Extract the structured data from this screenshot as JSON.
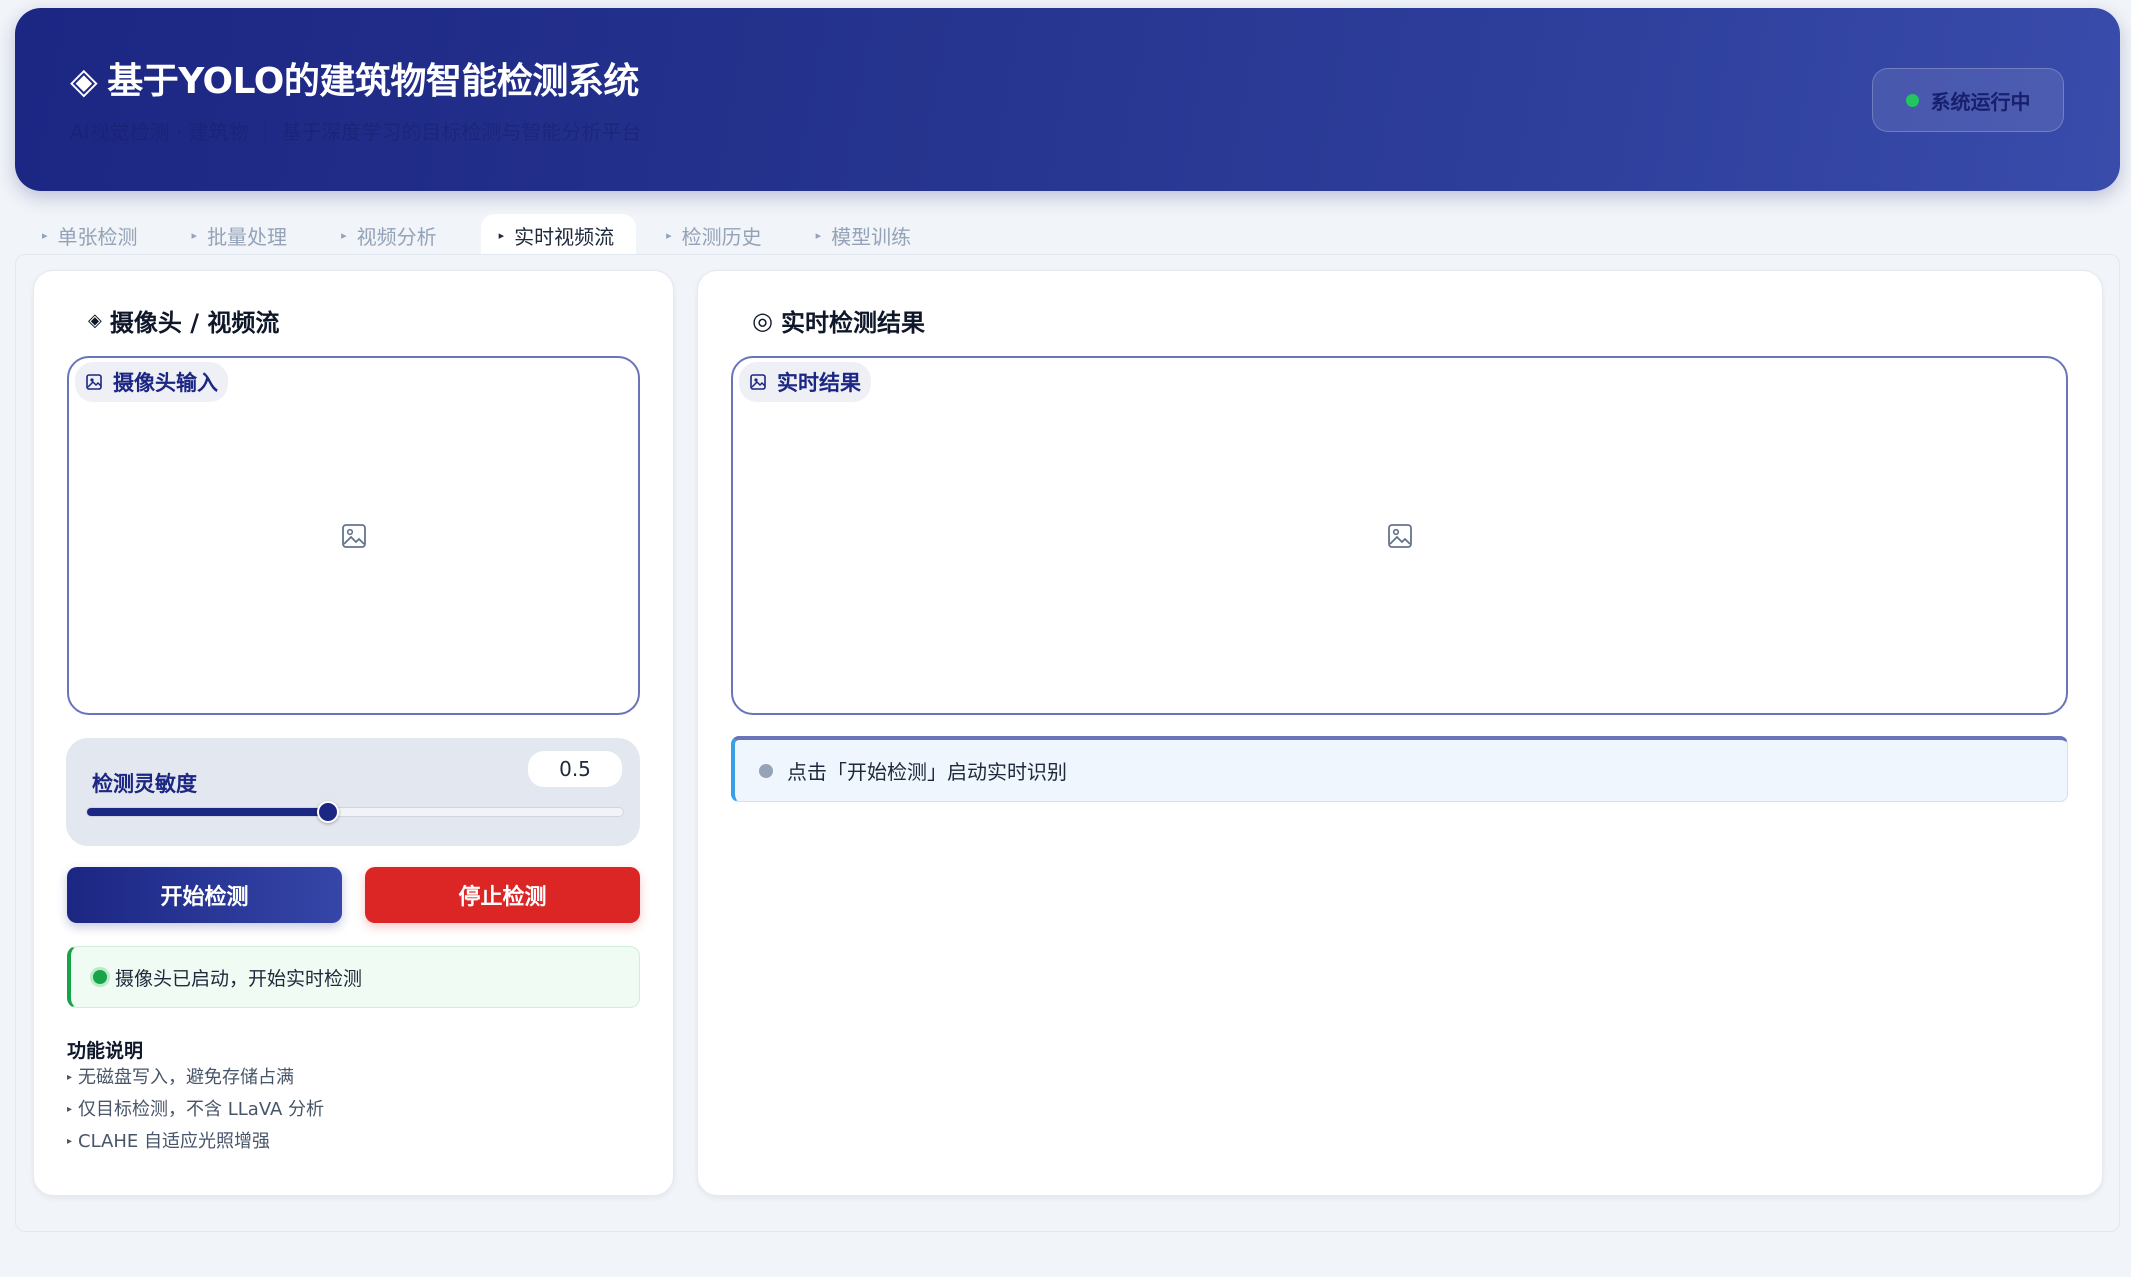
{
  "header": {
    "title": "基于YOLO的建筑物智能检测系统",
    "title_icon": "◈",
    "subtitle": "AI视觉检测 · 建筑物 ｜ 基于深度学习的目标检测与智能分析平台",
    "status": "系统运行中",
    "status_color": "#22c55e"
  },
  "tabs": [
    {
      "label": "单张检测"
    },
    {
      "label": "批量处理"
    },
    {
      "label": "视频分析"
    },
    {
      "label": "实时视频流",
      "active": true
    },
    {
      "label": "检测历史"
    },
    {
      "label": "模型训练"
    }
  ],
  "left_panel": {
    "title": "摄像头 / 视频流",
    "title_icon": "◈",
    "input_label": "摄像头输入",
    "slider": {
      "label": "检测灵敏度",
      "value": "0.5",
      "min": 0,
      "max": 1,
      "fraction": 0.45
    },
    "start_button": "开始检测",
    "stop_button": "停止检测",
    "status_text": "摄像头已启动，开始实时检测",
    "help": {
      "title": "功能说明",
      "items": [
        "无磁盘写入，避免存储占满",
        "仅目标检测，不含 LLaVA 分析",
        "CLAHE 自适应光照增强"
      ]
    }
  },
  "right_panel": {
    "title": "实时检测结果",
    "title_icon": "◎",
    "output_label": "实时结果",
    "info_text": "点击「开始检测」启动实时识别"
  },
  "colors": {
    "primary": "#1c2683",
    "danger": "#dc2626",
    "success": "#16a34a",
    "info": "#3aa0e6"
  }
}
